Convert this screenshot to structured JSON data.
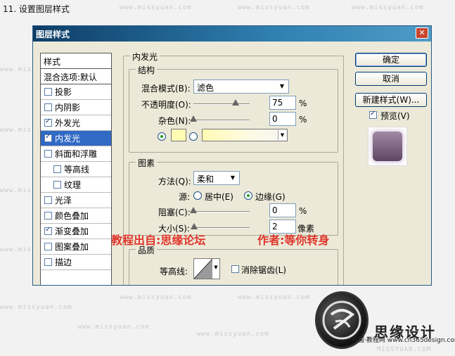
{
  "step_title": "11. 设置图层样式",
  "watermark_text": "www.missyuan.com",
  "watermark_short": "MISSYUAN.COM",
  "dialog": {
    "title": "图层样式",
    "close_glyph": "✕"
  },
  "left_panel": {
    "header": "样式",
    "blend_options": "混合选项:默认",
    "items": [
      {
        "label": "投影",
        "checked": false,
        "sub": false,
        "selected": false
      },
      {
        "label": "内阴影",
        "checked": false,
        "sub": false,
        "selected": false
      },
      {
        "label": "外发光",
        "checked": true,
        "sub": false,
        "selected": false
      },
      {
        "label": "内发光",
        "checked": true,
        "sub": false,
        "selected": true
      },
      {
        "label": "斜面和浮雕",
        "checked": false,
        "sub": false,
        "selected": false
      },
      {
        "label": "等高线",
        "checked": false,
        "sub": true,
        "selected": false
      },
      {
        "label": "纹理",
        "checked": false,
        "sub": true,
        "selected": false
      },
      {
        "label": "光泽",
        "checked": false,
        "sub": false,
        "selected": false
      },
      {
        "label": "颜色叠加",
        "checked": false,
        "sub": false,
        "selected": false
      },
      {
        "label": "渐变叠加",
        "checked": true,
        "sub": false,
        "selected": false
      },
      {
        "label": "图案叠加",
        "checked": false,
        "sub": false,
        "selected": false
      },
      {
        "label": "描边",
        "checked": false,
        "sub": false,
        "selected": false
      }
    ]
  },
  "inner_glow": {
    "section_title": "内发光",
    "structure": {
      "title": "结构",
      "blend_mode_label": "混合模式(B):",
      "blend_mode_value": "滤色",
      "opacity_label": "不透明度(O):",
      "opacity_value": "75",
      "opacity_unit": "%",
      "opacity_fraction": 0.75,
      "noise_label": "杂色(N):",
      "noise_value": "0",
      "noise_unit": "%",
      "noise_fraction": 0,
      "glow_color": "#fffbb3"
    },
    "elements": {
      "title": "图素",
      "method_label": "方法(Q):",
      "method_value": "柔和",
      "source_label": "源:",
      "source_center": "居中(E)",
      "source_edge": "边缘(G)",
      "choke_label": "阻塞(C):",
      "choke_value": "0",
      "choke_unit": "%",
      "choke_fraction": 0,
      "size_label": "大小(S):",
      "size_value": "2",
      "size_unit": "像素",
      "size_fraction": 0.01
    },
    "quality": {
      "title": "品质",
      "contour_label": "等高线:",
      "anti_alias_label": "消除锯齿(L)"
    }
  },
  "buttons": {
    "ok": "确定",
    "cancel": "取消",
    "new_style": "新建样式(W)...",
    "preview_label": "预览(V)"
  },
  "overlay": {
    "tutorial_source": "教程出自:思缘论坛",
    "author": "作者:等你转身",
    "site_logo_text": "思缘设计",
    "site_url": "中国·教程网 www.cn365design.com"
  },
  "colors": {
    "selection": "#316ac5",
    "title_bar": "#0d3d66",
    "red_text": "#e0352a"
  }
}
